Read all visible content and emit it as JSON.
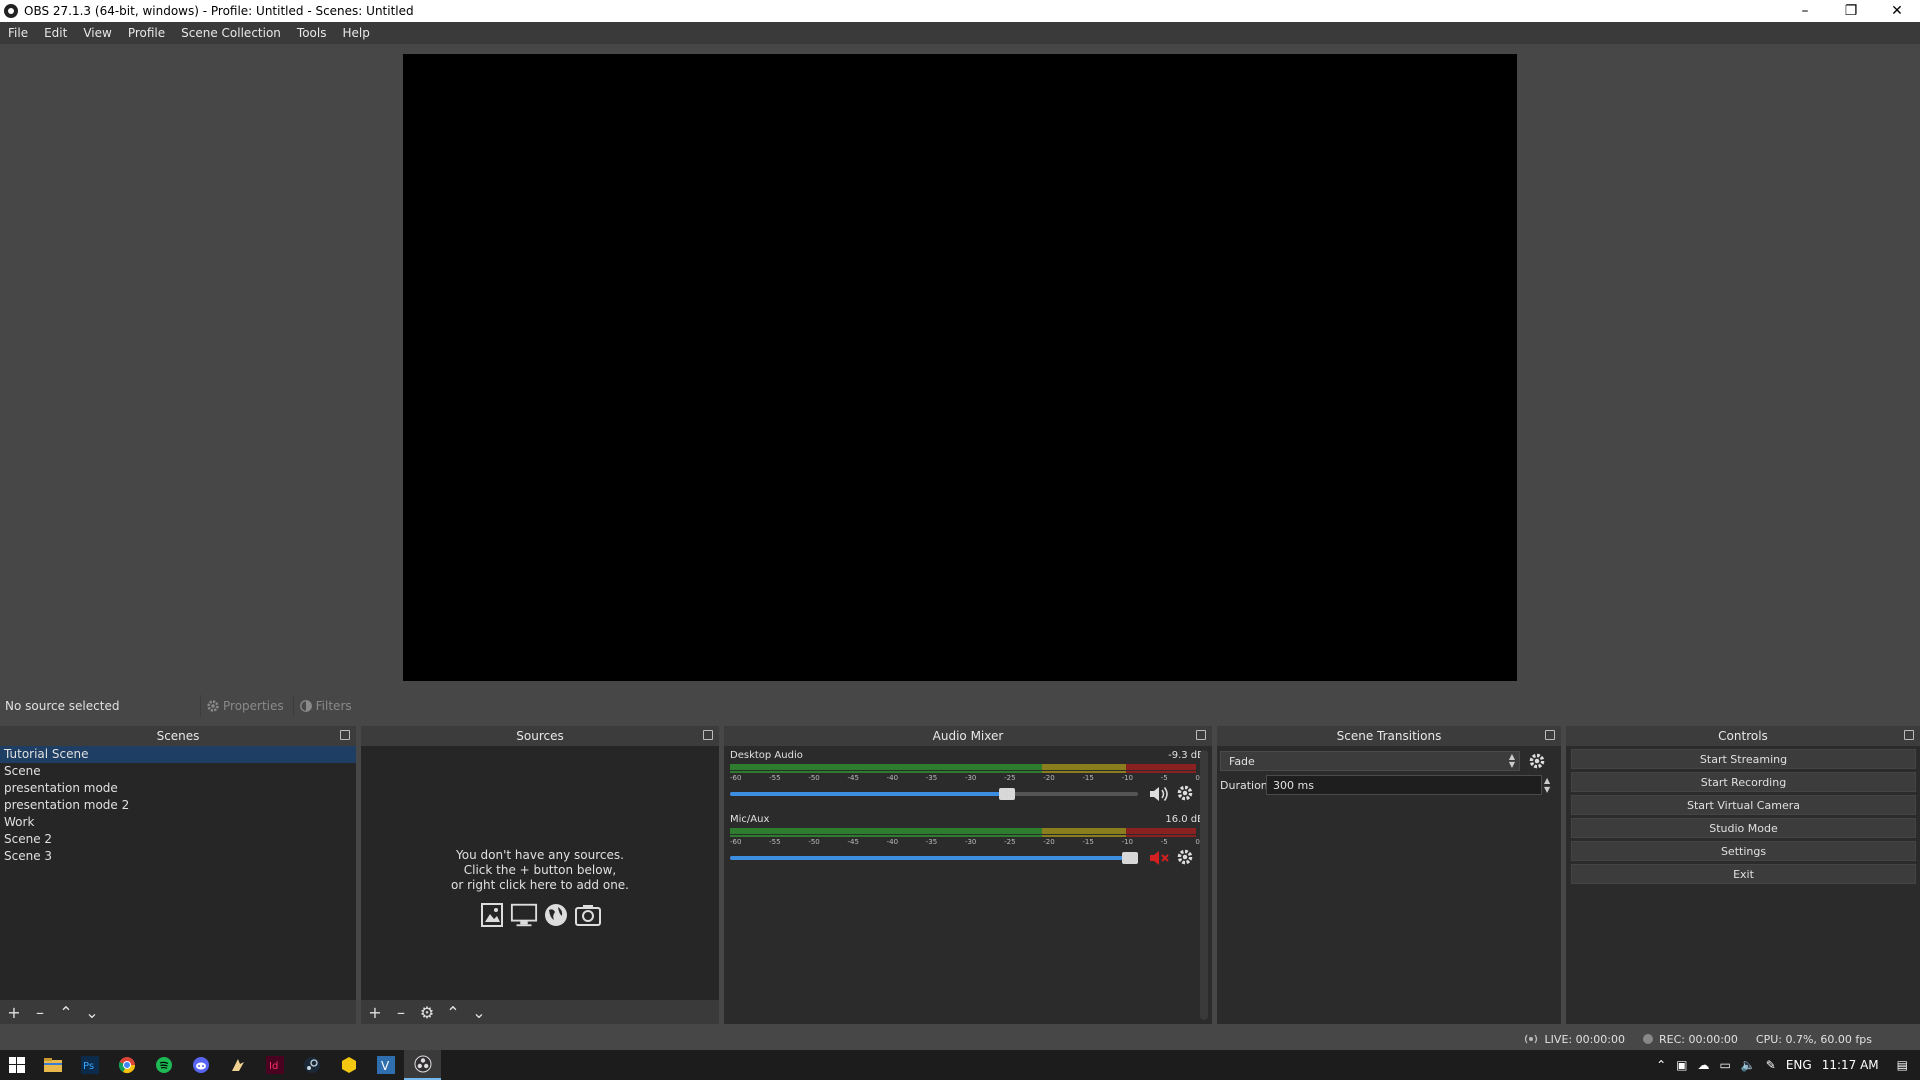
{
  "window": {
    "title": "OBS 27.1.3 (64-bit, windows) - Profile: Untitled - Scenes: Untitled",
    "controls": [
      "–",
      "❐",
      "✕"
    ]
  },
  "menu": [
    "File",
    "Edit",
    "View",
    "Profile",
    "Scene Collection",
    "Tools",
    "Help"
  ],
  "source_bar": {
    "status": "No source selected",
    "properties_label": "Properties",
    "filters_label": "Filters"
  },
  "scenes": {
    "title": "Scenes",
    "items": [
      "Tutorial Scene",
      "Scene",
      "presentation mode",
      "presentation mode 2",
      "Work",
      "Scene 2",
      "Scene 3"
    ],
    "selected": "Tutorial Scene"
  },
  "sources": {
    "title": "Sources",
    "empty_line1": "You don't have any sources.",
    "empty_line2": "Click the + button below,",
    "empty_line3": "or right click here to add one."
  },
  "mixer": {
    "title": "Audio Mixer",
    "ticks": [
      "-60",
      "-55",
      "-50",
      "-45",
      "-40",
      "-35",
      "-30",
      "-25",
      "-20",
      "-15",
      "-10",
      "-5",
      "0"
    ],
    "channels": [
      {
        "name": "Desktop Audio",
        "db": "-9.3 dB",
        "volume": 0.68,
        "muted": false
      },
      {
        "name": "Mic/Aux",
        "db": "16.0 dB",
        "volume": 0.98,
        "muted": true
      }
    ]
  },
  "transitions": {
    "title": "Scene Transitions",
    "selected": "Fade",
    "duration_label": "Duration",
    "duration_value": "300 ms"
  },
  "controls": {
    "title": "Controls",
    "buttons": [
      "Start Streaming",
      "Start Recording",
      "Start Virtual Camera",
      "Studio Mode",
      "Settings",
      "Exit"
    ]
  },
  "status": {
    "live": "LIVE: 00:00:00",
    "rec": "REC: 00:00:00",
    "cpu": "CPU: 0.7%, 60.00 fps"
  },
  "taskbar": {
    "apps": [
      "file-explorer-icon",
      "photoshop-icon",
      "chrome-icon",
      "spotify-icon",
      "discord-icon",
      "app-icon",
      "indesign-icon",
      "steam-icon",
      "app-icon",
      "vectorworks-icon",
      "obs-icon"
    ],
    "lang": "ENG",
    "time": "11:17 AM"
  },
  "colors": {
    "accent": "#3b8ee0",
    "selected_scene": "#1e3e63",
    "muted": "#d42020"
  }
}
